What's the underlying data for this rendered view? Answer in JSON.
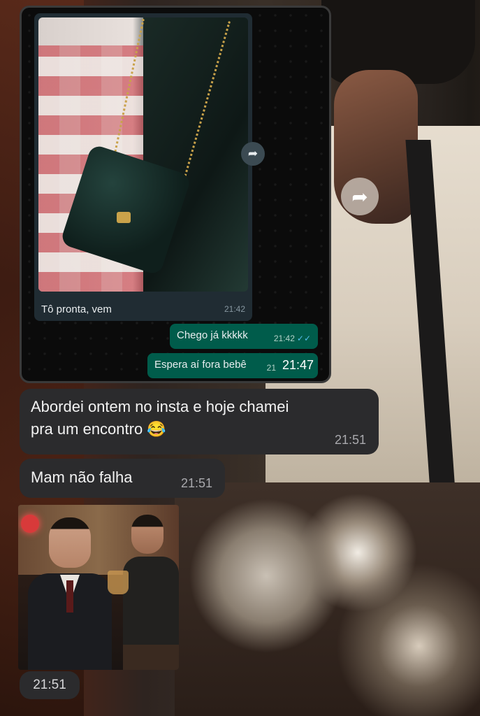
{
  "embedded_chat": {
    "photo_caption": "Tô pronta, vem",
    "photo_time": "21:42",
    "out_messages": [
      {
        "text": "Chego já kkkkk",
        "time": "21:42",
        "ticks": "✓✓"
      },
      {
        "text": "Espera aí fora bebê",
        "time": "21"
      }
    ],
    "overlay_time": "21:47"
  },
  "messages": [
    {
      "text_line1": "Abordei ontem no insta e hoje chamei",
      "text_line2": "pra um encontro 😂",
      "time": "21:51"
    },
    {
      "text": "Mam não falha",
      "time": "21:51"
    }
  ],
  "image_message": {
    "time": "21:51"
  },
  "icons": {
    "forward": "forward-icon",
    "read_receipt": "double-check-icon"
  }
}
